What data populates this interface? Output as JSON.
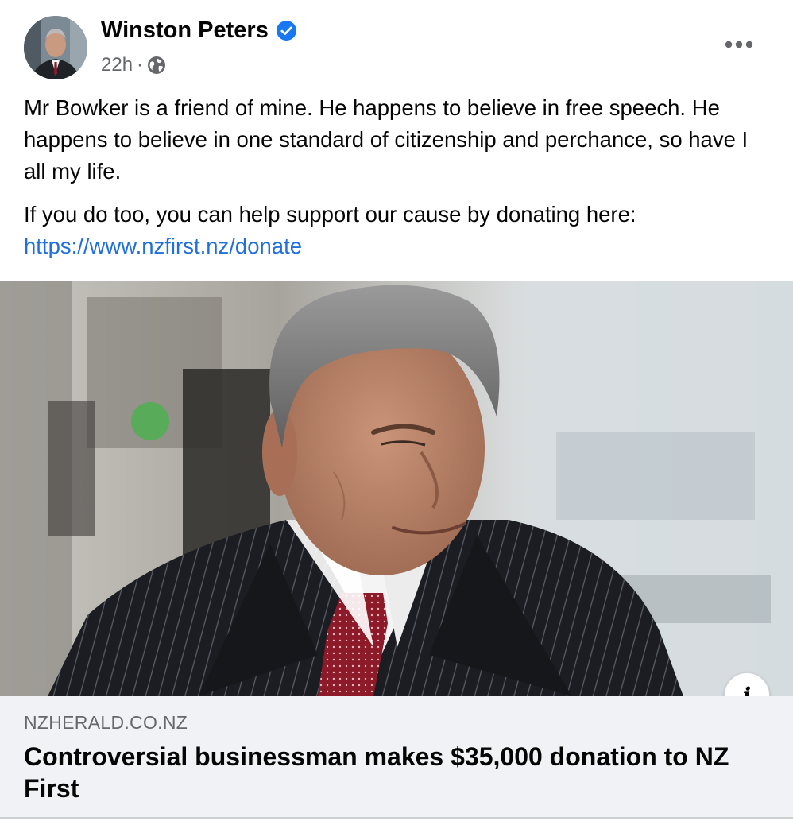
{
  "post": {
    "author": "Winston Peters",
    "time": "22h",
    "separator": "·",
    "verified_icon": "verified-badge-icon",
    "privacy_icon": "globe-icon",
    "text_paragraphs": [
      "Mr Bowker is a friend of mine. He happens to believe in free speech. He happens to believe in one standard of citizenship and perchance, so have I all my life.",
      "If you do too, you can help support our cause by donating here:"
    ],
    "donate_link": "https://www.nzfirst.nz/donate"
  },
  "preview": {
    "source": "NZHERALD.CO.NZ",
    "headline": "Controversial businessman makes $35,000 donation to NZ First",
    "info_label": "i"
  },
  "colors": {
    "link": "#216fdb",
    "verified": "#1877f2",
    "secondary_text": "#65676b",
    "preview_bg": "#f0f2f5"
  }
}
